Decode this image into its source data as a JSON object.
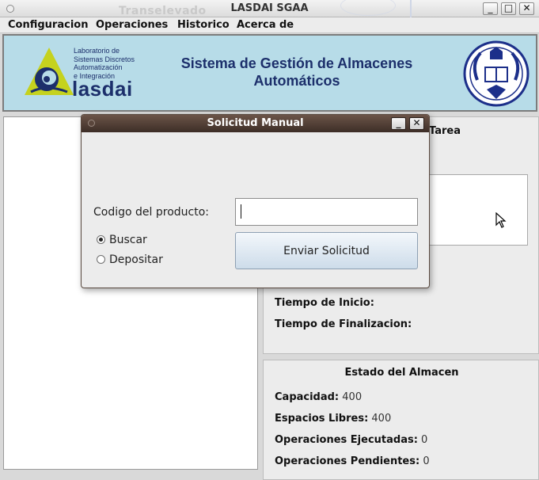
{
  "window": {
    "title": "LASDAI SGAA",
    "ghost_text": "Transelevado",
    "minimize_label": "_",
    "maximize_label": "□",
    "close_label": "✕"
  },
  "menu": [
    {
      "label": "Configuracion"
    },
    {
      "label": "Operaciones"
    },
    {
      "label": "Historico"
    },
    {
      "label": "Acerca de"
    }
  ],
  "banner": {
    "logo_lines": [
      "Laboratorio de",
      "Sistemas Discretos",
      "Automatización",
      "e Integración"
    ],
    "logo_word": "lasdai",
    "title_line1": "Sistema de Gestión de Almacenes",
    "title_line2": "Automáticos",
    "seal_icon": "university-seal-icon",
    "colors": {
      "background": "#b7dce8",
      "navy": "#1c2f6b",
      "logo_green": "#c5d21e"
    }
  },
  "task_panel": {
    "header": "Tarea",
    "start_label": "Tiempo de Inicio:",
    "end_label": "Tiempo de Finalizacion:"
  },
  "warehouse": {
    "header": "Estado del Almacen",
    "capacity_label": "Capacidad:",
    "capacity_value": "400",
    "free_label": "Espacios Libres:",
    "free_value": "400",
    "executed_label": "Operaciones Ejecutadas:",
    "executed_value": "0",
    "pending_label": "Operaciones Pendientes:",
    "pending_value": "0"
  },
  "dialog": {
    "title": "Solicitud Manual",
    "minimize_label": "_",
    "close_label": "✕",
    "product_code_label": "Codigo del producto:",
    "product_code_value": "",
    "radio_search": "Buscar",
    "radio_deposit": "Depositar",
    "selected": "Buscar",
    "send_label": "Enviar Solicitud"
  }
}
